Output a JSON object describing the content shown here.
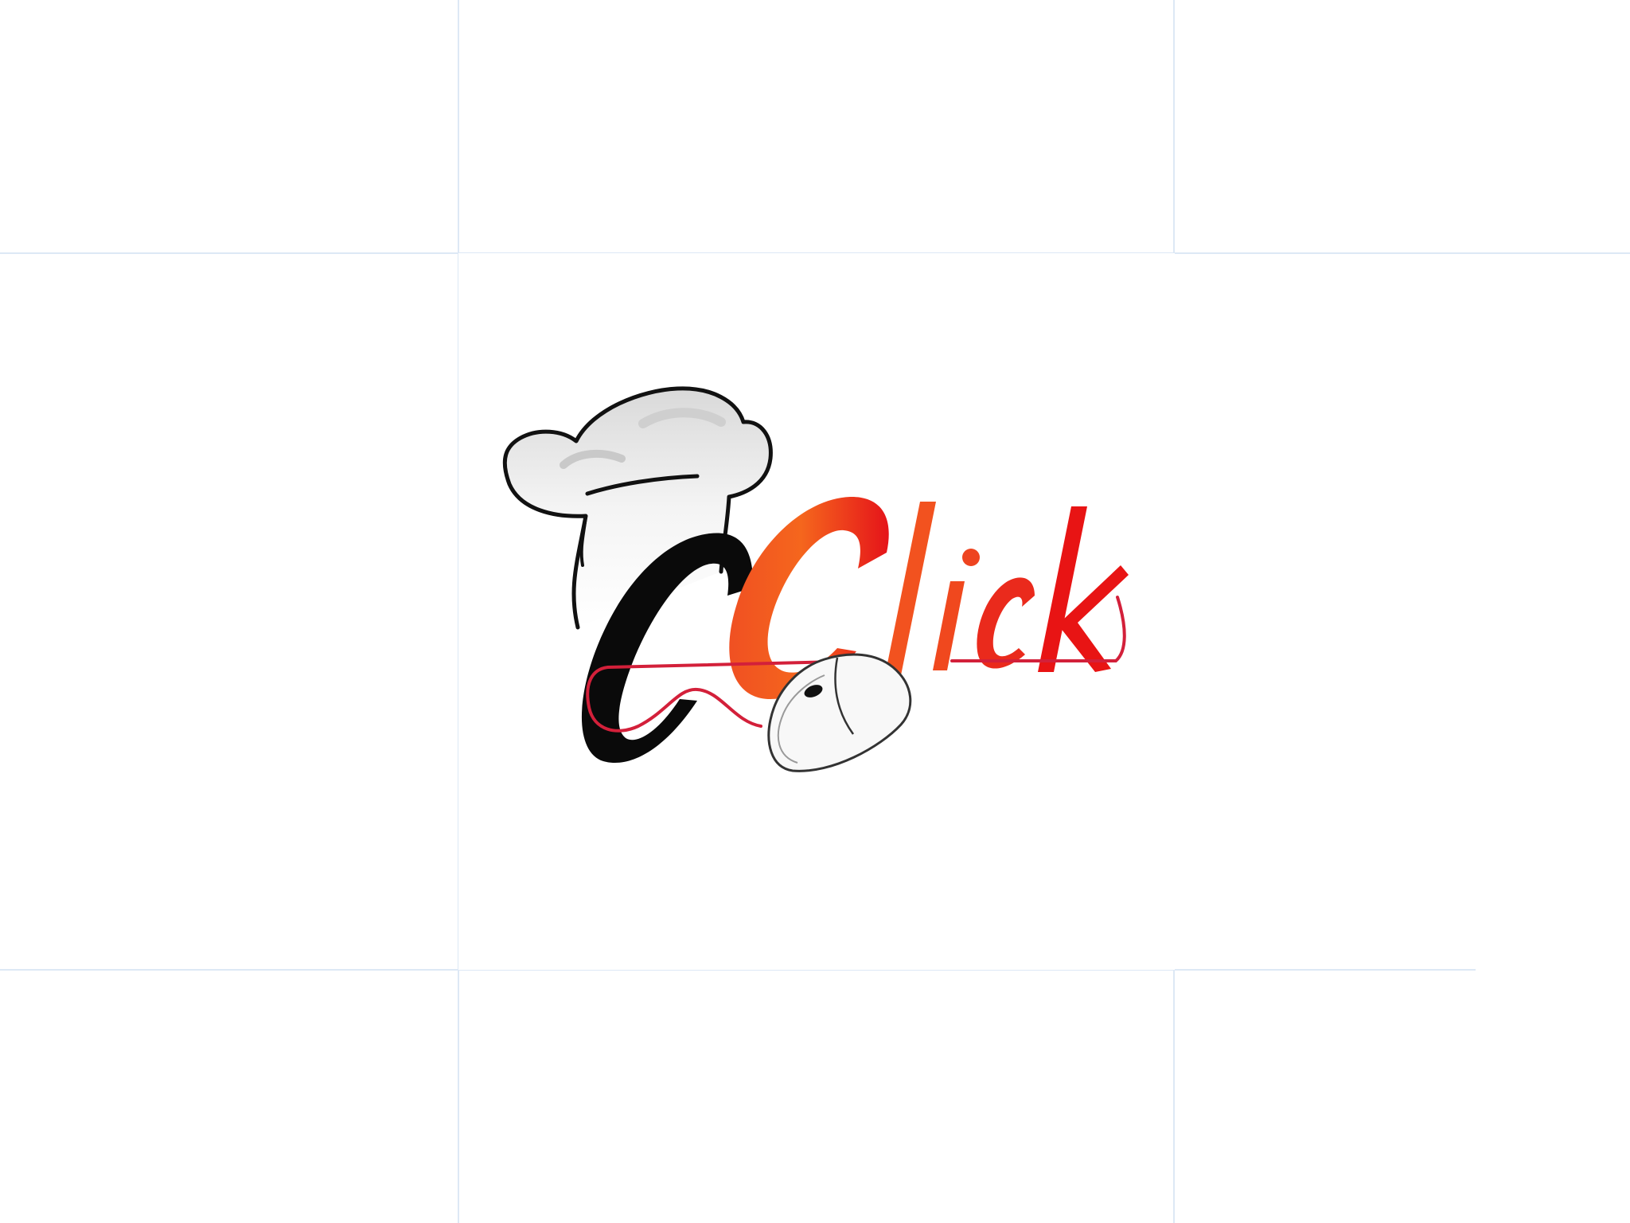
{
  "logo": {
    "text": "CClick",
    "first_letter": "C",
    "wordmark": "Click",
    "icon_hat": "chef-hat-icon",
    "icon_mouse": "computer-mouse-icon"
  },
  "colors": {
    "background": "#ffffff",
    "grid": "#dde8f5",
    "black_letter": "#0a0a0a",
    "red_dark": "#e81414",
    "red_orange": "#f2521f",
    "cable": "#d3203a"
  }
}
